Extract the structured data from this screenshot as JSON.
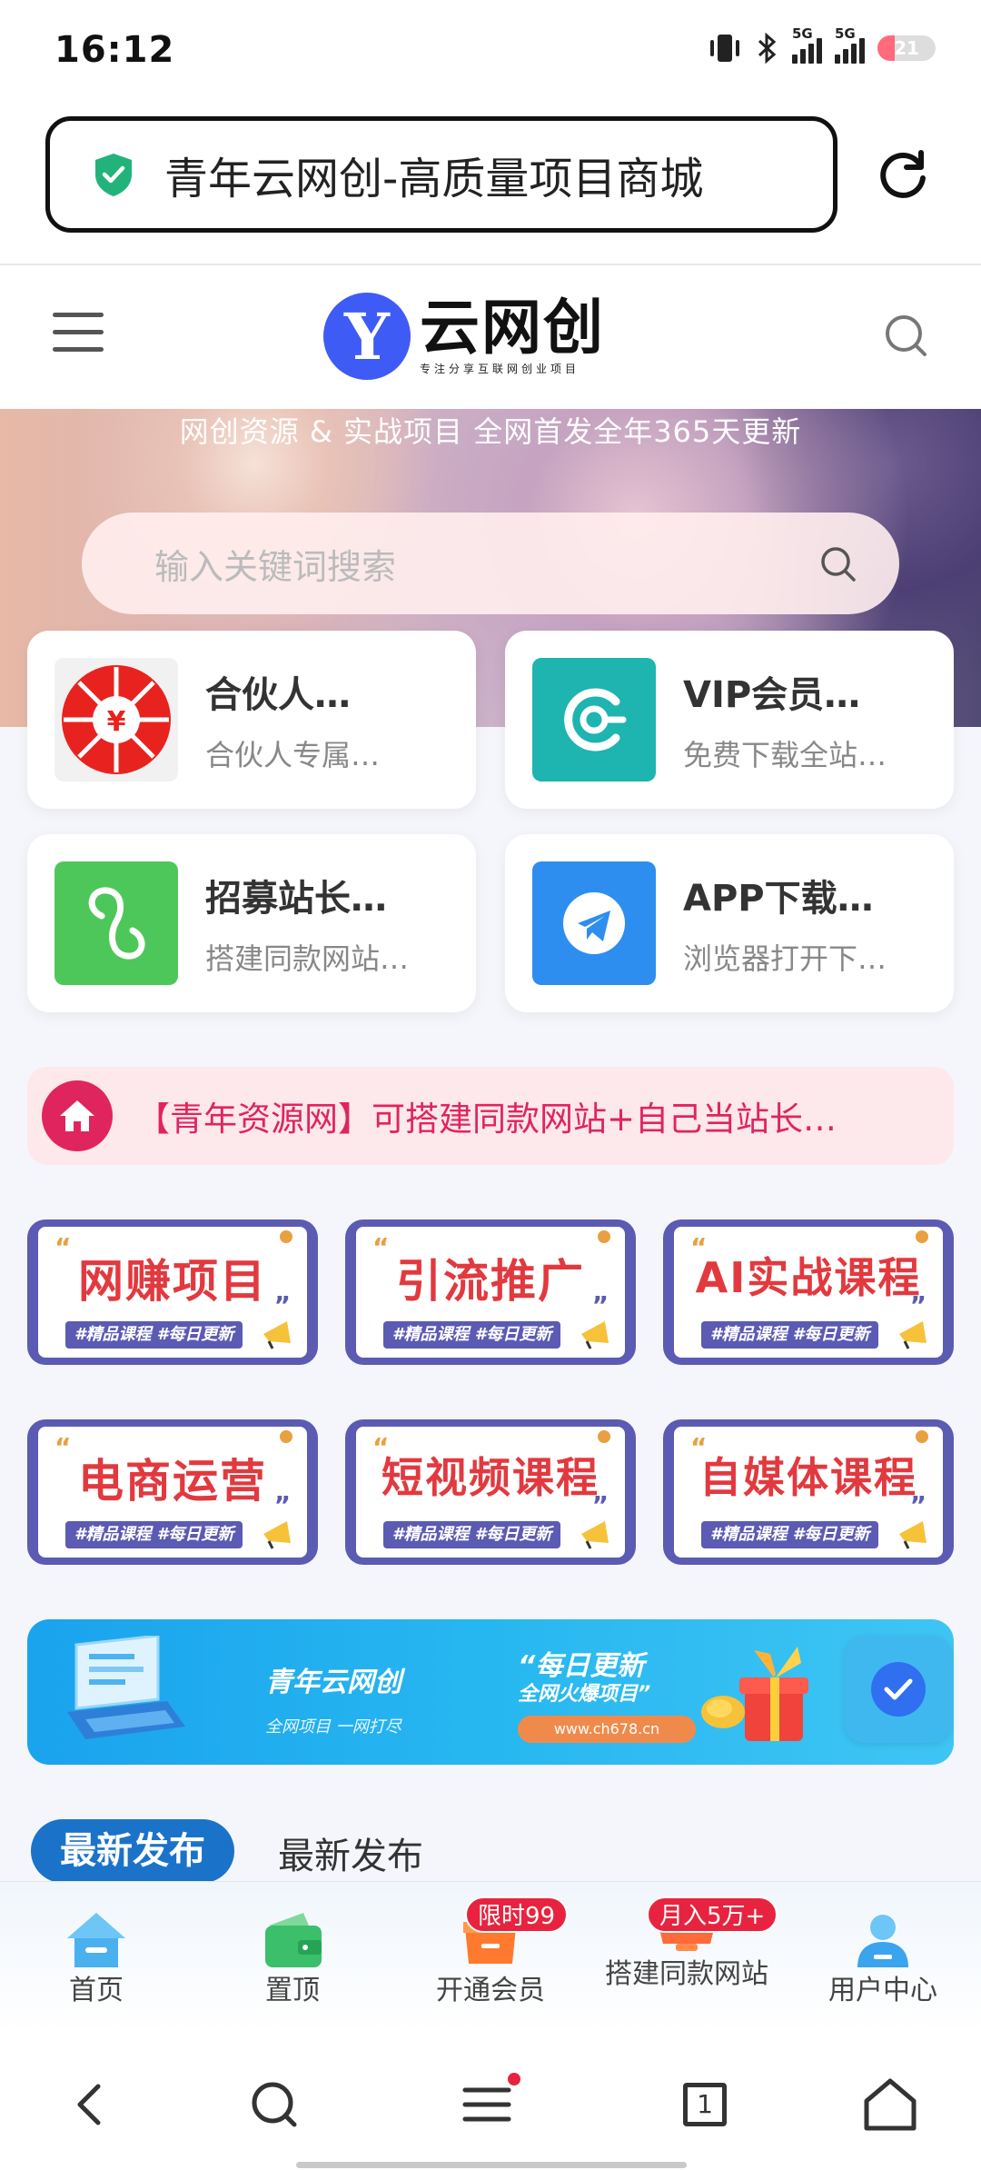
{
  "status_bar": {
    "time": "16:12",
    "network1": "5G",
    "network2": "5G",
    "battery": "21"
  },
  "browser": {
    "url_title": "青年云网创-高质量项目商城"
  },
  "site": {
    "logo_letter": "Y",
    "logo_text": "云网创",
    "logo_slogan": "专注分享互联网创业项目"
  },
  "banner": {
    "text": "网创资源 & 实战项目 全网首发全年365天更新",
    "search_placeholder": "输入关键词搜索"
  },
  "cards": [
    {
      "title": "合伙人…",
      "subtitle": "合伙人专属…",
      "icon": "partner-icon",
      "color": "#e8231f"
    },
    {
      "title": "VIP会员…",
      "subtitle": "免费下载全站…",
      "icon": "vip-icon",
      "color": "#1eb4b0"
    },
    {
      "title": "招募站长…",
      "subtitle": "搭建同款网站…",
      "icon": "link-icon",
      "color": "#4ec75a"
    },
    {
      "title": "APP下载…",
      "subtitle": "浏览器打开下…",
      "icon": "telegram-icon",
      "color": "#2d8ef0"
    }
  ],
  "notice": {
    "text": "【青年资源网】可搭建同款网站+自己当站长…"
  },
  "categories": [
    {
      "title": "网赚项目",
      "tags": "#精品课程 #每日更新"
    },
    {
      "title": "引流推广",
      "tags": "#精品课程 #每日更新"
    },
    {
      "title": "AI实战课程",
      "tags": "#精品课程 #每日更新"
    },
    {
      "title": "电商运营",
      "tags": "#精品课程 #每日更新"
    },
    {
      "title": "短视频课程",
      "tags": "#精品课程 #每日更新"
    },
    {
      "title": "自媒体课程",
      "tags": "#精品课程 #每日更新"
    }
  ],
  "promo": {
    "brand": "青年云网创",
    "sub": "全网项目 一网打尽",
    "quote1": "“每日更新",
    "quote2": "全网火爆项目”",
    "url": "www.ch678.cn"
  },
  "section_tabs": [
    "最新发布",
    "最新发布"
  ],
  "bottom_nav": [
    {
      "label": "首页",
      "icon": "home-icon"
    },
    {
      "label": "置顶",
      "icon": "wallet-icon"
    },
    {
      "label": "开通会员",
      "icon": "shop-icon",
      "badge": "限时99"
    },
    {
      "label": "搭建同款网站",
      "icon": "hat-icon",
      "badge": "月入5万+"
    },
    {
      "label": "用户中心",
      "icon": "user-icon"
    }
  ],
  "system_nav": {
    "tab_count": "1"
  },
  "colors": {
    "accent_blue": "#1a73c9",
    "notice_red": "#e0245e",
    "tile_purple": "#5b5bb3",
    "tile_red": "#e2393f"
  }
}
